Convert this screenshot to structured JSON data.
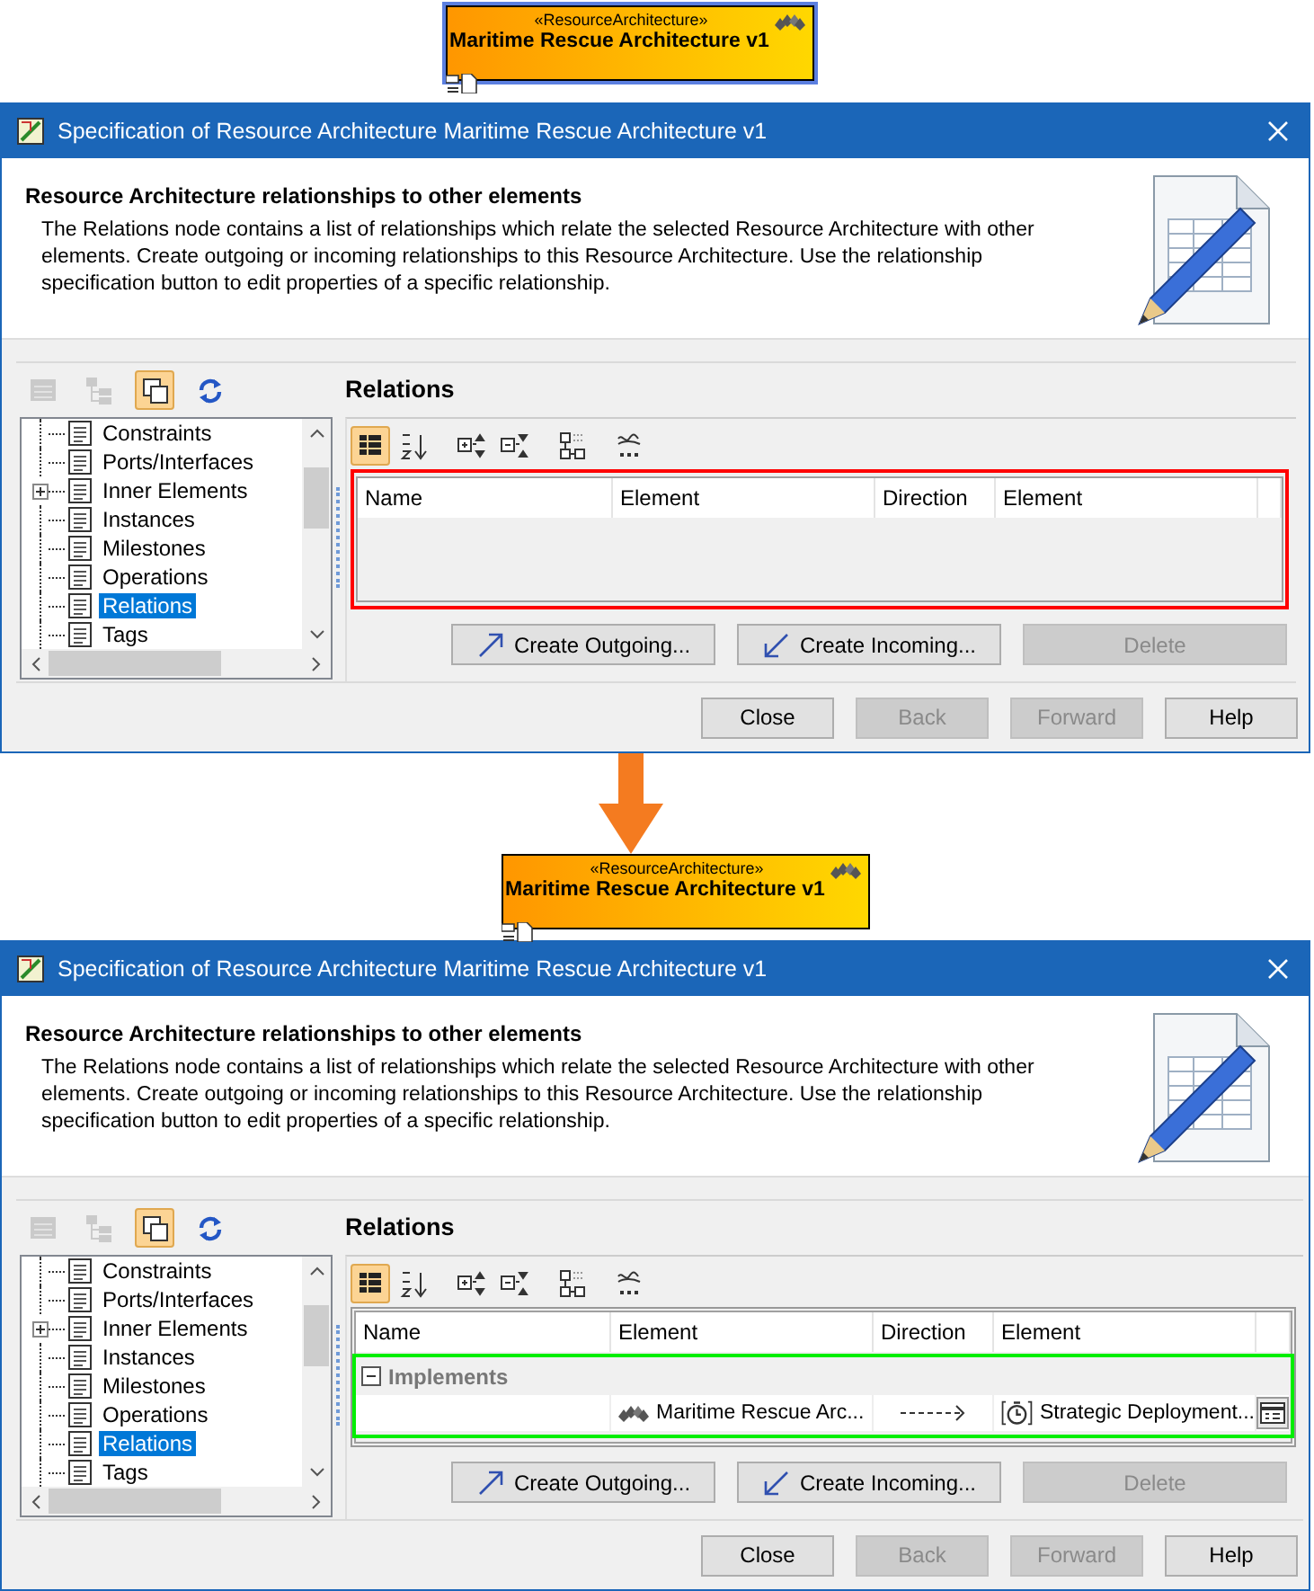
{
  "panels": [
    {
      "diagram_block": {
        "stereotype": "«ResourceArchitecture»",
        "name": "Maritime Rescue Architecture v1",
        "selected": true
      },
      "dialog": {
        "title": "Specification of Resource Architecture Maritime Rescue Architecture v1",
        "header": {
          "heading": "Resource Architecture relationships to other elements",
          "description": "The Relations node contains a list of relationships which relate the selected Resource Architecture with other elements. Create outgoing or incoming relationships to this Resource Architecture. Use the relationship specification button to edit properties of a specific relationship."
        },
        "tree_toolbar": [
          {
            "kind": "table",
            "selected": false,
            "disabled": true
          },
          {
            "kind": "tree",
            "selected": false,
            "disabled": true
          },
          {
            "kind": "copy",
            "selected": true,
            "disabled": false
          },
          {
            "kind": "refresh",
            "selected": false,
            "disabled": false
          }
        ],
        "tree": [
          {
            "label": "Constraints",
            "kind": "leaf",
            "selected": false
          },
          {
            "label": "Ports/Interfaces",
            "kind": "leaf",
            "selected": false
          },
          {
            "label": "Inner Elements",
            "kind": "collapsed",
            "selected": false
          },
          {
            "label": "Instances",
            "kind": "leaf",
            "selected": false
          },
          {
            "label": "Milestones",
            "kind": "leaf",
            "selected": false
          },
          {
            "label": "Operations",
            "kind": "leaf",
            "selected": false
          },
          {
            "label": "Relations",
            "kind": "leaf",
            "selected": true
          },
          {
            "label": "Tags",
            "kind": "leaf",
            "selected": false
          }
        ],
        "relations": {
          "heading": "Relations",
          "toolbar": [
            {
              "kind": "grid",
              "selected": true
            },
            {
              "kind": "sort",
              "selected": false
            },
            {
              "kind": "expand",
              "selected": false
            },
            {
              "kind": "collapse",
              "selected": false
            },
            {
              "kind": "hierarchy",
              "selected": false
            },
            {
              "kind": "text",
              "selected": false
            }
          ],
          "columns": [
            "Name",
            "Element",
            "Direction",
            "Element"
          ],
          "highlight": {
            "kind": "table",
            "color": "#ff0000"
          }
        },
        "action_buttons": [
          {
            "label": "Create Outgoing...",
            "kind": "outgoing",
            "disabled": false
          },
          {
            "label": "Create Incoming...",
            "kind": "incoming",
            "disabled": false
          },
          {
            "label": "Delete",
            "kind": "plain",
            "disabled": true
          }
        ],
        "footer_buttons": [
          {
            "label": "Close",
            "disabled": false
          },
          {
            "label": "Back",
            "disabled": true
          },
          {
            "label": "Forward",
            "disabled": true
          },
          {
            "label": "Help",
            "disabled": false
          }
        ]
      }
    },
    {
      "diagram_block": {
        "stereotype": "«ResourceArchitecture»",
        "name": "Maritime Rescue Architecture v1",
        "selected": false
      },
      "dialog": {
        "title": "Specification of Resource Architecture Maritime Rescue Architecture v1",
        "header": {
          "heading": "Resource Architecture relationships to other elements",
          "description": "The Relations node contains a list of relationships which relate the selected Resource Architecture with other elements. Create outgoing or incoming relationships to this Resource Architecture. Use the relationship specification button to edit properties of a specific relationship."
        },
        "tree_toolbar": [
          {
            "kind": "table",
            "selected": false,
            "disabled": true
          },
          {
            "kind": "tree",
            "selected": false,
            "disabled": true
          },
          {
            "kind": "copy",
            "selected": true,
            "disabled": false
          },
          {
            "kind": "refresh",
            "selected": false,
            "disabled": false
          }
        ],
        "tree": [
          {
            "label": "Constraints",
            "kind": "leaf",
            "selected": false
          },
          {
            "label": "Ports/Interfaces",
            "kind": "leaf",
            "selected": false
          },
          {
            "label": "Inner Elements",
            "kind": "collapsed",
            "selected": false
          },
          {
            "label": "Instances",
            "kind": "leaf",
            "selected": false
          },
          {
            "label": "Milestones",
            "kind": "leaf",
            "selected": false
          },
          {
            "label": "Operations",
            "kind": "leaf",
            "selected": false
          },
          {
            "label": "Relations",
            "kind": "leaf",
            "selected": true
          },
          {
            "label": "Tags",
            "kind": "leaf",
            "selected": false
          }
        ],
        "relations": {
          "heading": "Relations",
          "toolbar": [
            {
              "kind": "grid",
              "selected": true
            },
            {
              "kind": "sort",
              "selected": false
            },
            {
              "kind": "expand",
              "selected": false
            },
            {
              "kind": "collapse",
              "selected": false
            },
            {
              "kind": "hierarchy",
              "selected": false
            },
            {
              "kind": "text",
              "selected": false
            }
          ],
          "columns": [
            "Name",
            "Element",
            "Direction",
            "Element"
          ],
          "highlight": {
            "kind": "rows",
            "color": "#00ee00"
          },
          "groups": [
            {
              "name": "Implements",
              "expanded": true,
              "rows": [
                {
                  "source": "Maritime Rescue Arc...",
                  "kind": "outgoing",
                  "target": "Strategic Deployment..."
                }
              ]
            }
          ]
        },
        "action_buttons": [
          {
            "label": "Create Outgoing...",
            "kind": "outgoing",
            "disabled": false
          },
          {
            "label": "Create Incoming...",
            "kind": "incoming",
            "disabled": false
          },
          {
            "label": "Delete",
            "kind": "plain",
            "disabled": true
          }
        ],
        "footer_buttons": [
          {
            "label": "Close",
            "disabled": false
          },
          {
            "label": "Back",
            "disabled": true
          },
          {
            "label": "Forward",
            "disabled": true
          },
          {
            "label": "Help",
            "disabled": false
          }
        ]
      }
    }
  ]
}
